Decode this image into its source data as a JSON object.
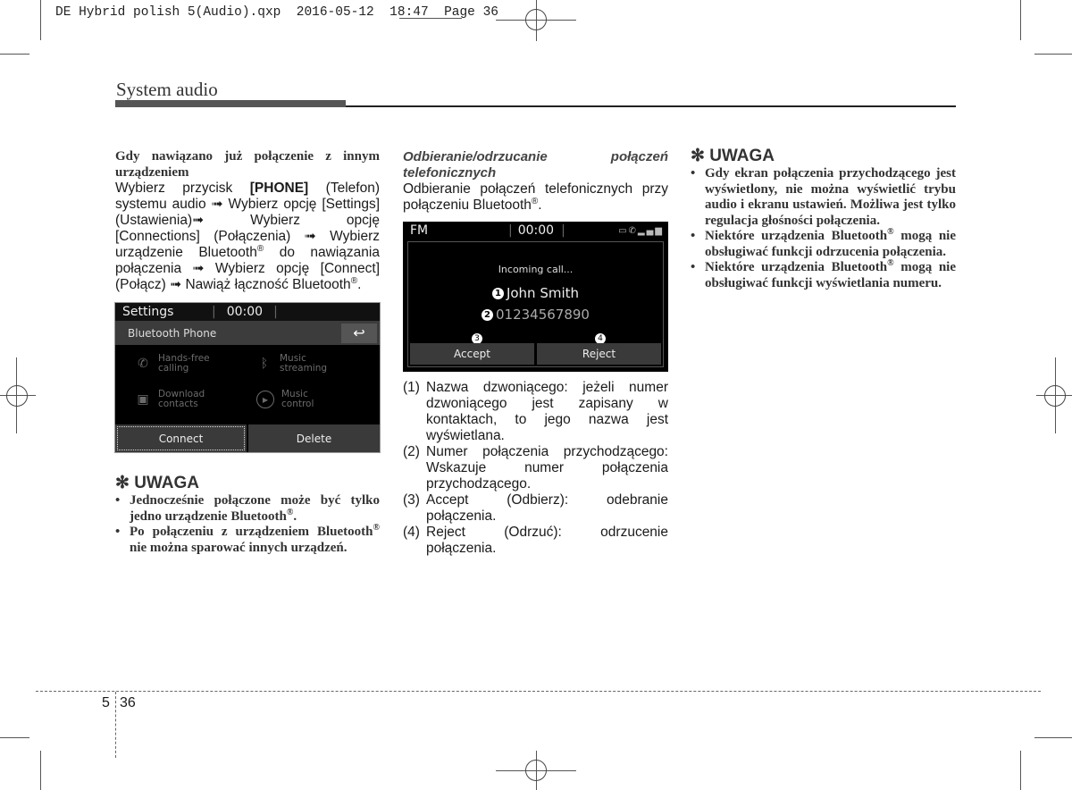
{
  "slug": {
    "text": "DE Hybrid polish 5(Audio).qxp  2016-05-12  18:47  Page 36"
  },
  "header": {
    "section_title": "System audio"
  },
  "left_column": {
    "heading": "Gdy nawiązano już połączenie z innym urządzeniem",
    "body_parts": {
      "p1": "Wybierz przycisk ",
      "phone": "[PHONE]",
      "p2": " (Telefon) systemu audio ➟ Wybierz opcję [Settings] (Ustawienia)➟ Wybierz opcję [Connections] (Połączenia) ➟ Wybierz urządzenie Bluetooth",
      "reg": "®",
      "p3": " do nawiązania połączenia ➟ Wybierz opcję [Connect] (Połącz) ➟ Nawiąż łączność Bluetooth",
      "p4": "."
    },
    "screen": {
      "status_title": "Settings",
      "time": "00:00",
      "subbar_title": "Bluetooth Phone",
      "back_icon": "↩",
      "options": [
        {
          "icon": "handsfree-phone-icon",
          "glyph": "✆",
          "label1": "Hands-free",
          "label2": "calling"
        },
        {
          "icon": "bluetooth-music-icon",
          "glyph": "ᛒ",
          "label1": "Music",
          "label2": "streaming"
        },
        {
          "icon": "contacts-icon",
          "glyph": "▣",
          "label1": "Download",
          "label2": "contacts"
        },
        {
          "icon": "play-icon",
          "glyph": "▶",
          "label1": "Music",
          "label2": "control"
        }
      ],
      "connect_label": "Connect",
      "delete_label": "Delete"
    },
    "note": {
      "title": "✻ UWAGA",
      "bullets": [
        {
          "a": "Jednocześnie połączone może być tylko jedno urządzenie Bluetooth",
          "reg": "®",
          "b": "."
        },
        {
          "a": "Po połączeniu z urządzeniem Bluetooth",
          "reg": "®",
          "b": " nie można sparować innych urządzeń."
        }
      ]
    }
  },
  "middle_column": {
    "heading": "Odbieranie/odrzucanie połączeń telefonicznych",
    "body": "Odbieranie połączeń telefonicznych przy połączeniu Bluetooth",
    "reg": "®",
    "body_end": ".",
    "screen": {
      "source": "FM",
      "time": "00:00",
      "status_icons": [
        "battery-icon",
        "phone-icon",
        "signal-icon"
      ],
      "incoming": "Incoming call...",
      "caller_name": "John Smith",
      "caller_number": "01234567890",
      "marker1": "1",
      "marker2": "2",
      "marker3": "3",
      "marker4": "4",
      "accept_label": "Accept",
      "reject_label": "Reject"
    },
    "list": [
      {
        "n": "(1)",
        "t": "Nazwa dzwoniącego: jeżeli numer dzwoniącego jest zapisany w kontaktach, to jego nazwa jest wyświetlana."
      },
      {
        "n": "(2)",
        "t": "Numer połączenia przychodzącego: Wskazuje numer połączenia przychodzącego."
      },
      {
        "n": "(3)",
        "t": "Accept (Odbierz): odebranie połączenia."
      },
      {
        "n": "(4)",
        "t": "Reject (Odrzuć): odrzucenie połączenia."
      }
    ]
  },
  "right_column": {
    "note": {
      "title": "✻ UWAGA",
      "bullets": [
        {
          "a": "Gdy ekran połączenia przychodzącego jest wyświetlony, nie można wyświetlić trybu audio i ekranu ustawień. Możliwa jest tylko regulacja głośności połączenia.",
          "reg": "",
          "b": ""
        },
        {
          "a": "Niektóre urządzenia Bluetooth",
          "reg": "®",
          "b": " mogą nie obsługiwać funkcji odrzucenia połączenia."
        },
        {
          "a": "Niektóre urządzenia Bluetooth",
          "reg": "®",
          "b": " mogą nie obsługiwać funkcji wyświetlania numeru."
        }
      ]
    }
  },
  "footer": {
    "chapter": "5",
    "page": "36"
  }
}
